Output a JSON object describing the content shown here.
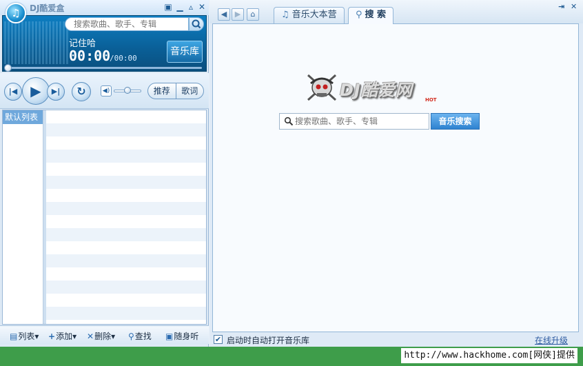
{
  "player": {
    "title": "DJ酷爱盒",
    "search_placeholder": "搜索歌曲、歌手、专辑",
    "song_title": "记住哈",
    "time_current": "00:00",
    "time_total": "/00:00",
    "music_library_label": "音乐库",
    "recommend_label": "推荐",
    "lyrics_label": "歌词",
    "default_list_label": "默认列表",
    "toolbar": {
      "list": "列表",
      "add": "添加",
      "delete": "删除",
      "find": "查找",
      "random": "随身听"
    },
    "progress_fraction": 0
  },
  "browser": {
    "tabs": [
      {
        "label": "音乐大本营",
        "icon": "music-note-icon"
      },
      {
        "label": "搜 索",
        "icon": "search-icon",
        "active": true
      }
    ],
    "brand_text": "DJ酷爱网",
    "brand_badge": "HOT",
    "search_placeholder": "搜索歌曲、歌手、专辑",
    "search_button": "音乐搜索",
    "autostart_label": "启动时自动打开音乐库",
    "upgrade_label": "在线升级"
  },
  "watermark": "http://www.hackhome.com[网侠]提供",
  "colors": {
    "accent": "#1a7fc4",
    "strip": "#3e9d4a",
    "search_button": "#3b8ad6"
  }
}
